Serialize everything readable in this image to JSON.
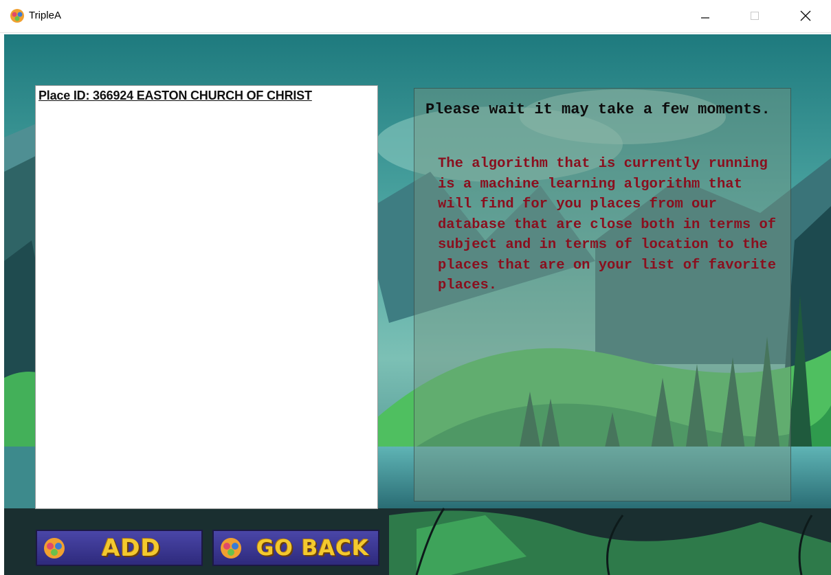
{
  "window": {
    "title": "TripleA",
    "controls": {
      "minimize": "minimize-icon",
      "maximize": "maximize-icon",
      "close": "close-icon"
    }
  },
  "places_list": {
    "items": [
      "Place ID: 366924 EASTON CHURCH OF CHRIST"
    ]
  },
  "info": {
    "heading": "Please wait it may take a few moments.",
    "body": "The algorithm that is currently running is a machine learning algorithm that will find for you places from our database that are close both in terms of subject and in terms of location to the places that are on your list of favorite places."
  },
  "buttons": {
    "add_label": "ADD",
    "back_label": "GO BACK"
  },
  "colors": {
    "heading": "#0d0d0d",
    "body_text": "#8a0f1e",
    "button_bg": "#3b37a0",
    "button_text": "#f3c92e"
  }
}
